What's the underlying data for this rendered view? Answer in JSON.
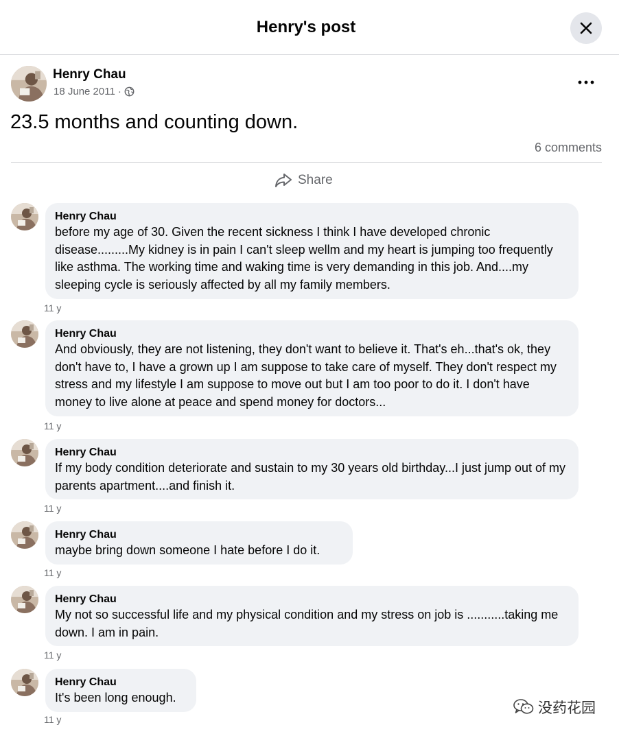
{
  "header": {
    "title": "Henry's post",
    "close_icon": "close-icon"
  },
  "post": {
    "author": "Henry Chau",
    "date": "18 June 2011",
    "dot": "·",
    "audience_icon": "globe-icon",
    "more_icon": "more-horizontal-icon",
    "more_label": "•••",
    "text": "23.5 months and counting down.",
    "comments_count": "6 comments",
    "share_label": "Share",
    "share_icon": "share-arrow-icon"
  },
  "comments": [
    {
      "author": "Henry Chau",
      "text": "before my age of 30. Given the recent sickness I think I have developed chronic disease.........My kidney is in pain I can't sleep wellm and my heart is jumping too frequently like asthma. The working time and waking time is very demanding in this job. And....my sleeping cycle is seriously affected by all my family members.",
      "time": "11 y"
    },
    {
      "author": "Henry Chau",
      "text": "And obviously, they are not listening, they don't want to believe it. That's eh...that's ok, they don't have to, I have a grown up I am suppose to take care of myself. They don't respect my stress and my lifestyle I am suppose to move out but I am too poor to do it. I don't have money to live alone at peace and spend money for doctors...",
      "time": "11 y"
    },
    {
      "author": "Henry Chau",
      "text": "If my body condition deteriorate and sustain to my 30 years old birthday...I just jump out of my parents apartment....and finish it.",
      "time": "11 y"
    },
    {
      "author": "Henry Chau",
      "text": "maybe bring down someone I hate before I do it.",
      "time": "11 y"
    },
    {
      "author": "Henry Chau",
      "text": "My not so successful life and my physical condition and my stress on job is ...........taking me down. I am in pain.",
      "time": "11 y"
    },
    {
      "author": "Henry Chau",
      "text": "It's been long enough.",
      "time": "11 y"
    }
  ],
  "watermark": {
    "icon": "wechat-logo-icon",
    "text": "没药花园"
  }
}
